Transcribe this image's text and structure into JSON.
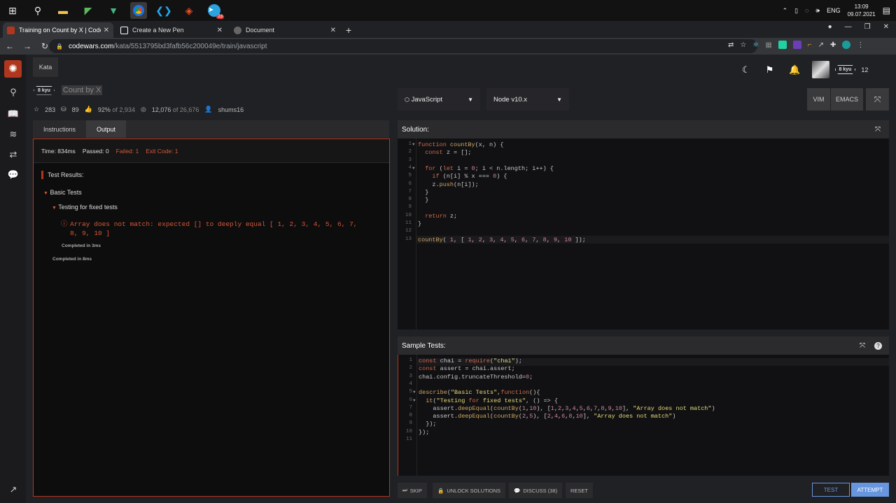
{
  "taskbar": {
    "time": "13:09",
    "date": "09.07.2021",
    "lang": "ENG",
    "badge_count": "23",
    "notif_count": "1"
  },
  "tabs": [
    {
      "label": "Training on Count by X | Codewars",
      "active": true,
      "color": "#b1361e"
    },
    {
      "label": "Create a New Pen",
      "active": false,
      "color": "#ffffff"
    },
    {
      "label": "Document",
      "active": false,
      "color": "#666666"
    }
  ],
  "address": {
    "host": "codewars.com",
    "path": "/kata/5513795bd3fafb56c200049e/train/javascript"
  },
  "header": {
    "kata_tab": "Kata",
    "user_rank": "8 kyu",
    "honor": "12"
  },
  "kata": {
    "rank": "8 kyu",
    "title": "Count by X",
    "stars": "283",
    "votes": "89",
    "satisfaction": "92%",
    "satisfaction_of": "of 2,934",
    "completed": "12,076",
    "completed_of": "of 26,676",
    "author": "shums16"
  },
  "panel_tabs": {
    "instructions": "Instructions",
    "output": "Output"
  },
  "run": {
    "time": "Time: 834ms",
    "passed": "Passed: 0",
    "failed": "Failed: 1",
    "exit": "Exit Code: 1"
  },
  "results": {
    "heading": "Test Results:",
    "group": "Basic Tests",
    "subgroup": "Testing for fixed tests",
    "error_line1": "Array does not match: expected [] to deeply equal [ 1, 2, 3, 4, 5, 6, 7,",
    "error_line2": "8, 9, 10 ]",
    "completed_inner": "Completed in 3ms",
    "completed_outer": "Completed in 8ms"
  },
  "toolbar": {
    "language": "JavaScript",
    "runtime": "Node v10.x",
    "vim": "VIM",
    "emacs": "EMACS"
  },
  "solution": {
    "title": "Solution:",
    "lines": [
      "function countBy(x, n) {",
      "  const z = [];",
      "",
      "  for (let i = 0; i < n.length; i++) {",
      "    if (n[i] % x === 0) {",
      "    z.push(n[i]);",
      "  }",
      "  }",
      "",
      "  return z;",
      "}",
      "",
      "countBy( 1, [ 1, 2, 3, 4, 5, 6, 7, 8, 9, 10 ]);"
    ]
  },
  "sample": {
    "title": "Sample Tests:",
    "lines": [
      "const chai = require(\"chai\");",
      "const assert = chai.assert;",
      "chai.config.truncateThreshold=0;",
      "",
      "describe(\"Basic Tests\",function(){",
      "  it(\"Testing for fixed tests\", () => {",
      "    assert.deepEqual(countBy(1,10), [1,2,3,4,5,6,7,8,9,10], \"Array does not match\")",
      "    assert.deepEqual(countBy(2,5), [2,4,6,8,10], \"Array does not match\")",
      "  });",
      "});",
      ""
    ]
  },
  "actions": {
    "skip": "SKIP",
    "unlock": "UNLOCK SOLUTIONS",
    "discuss": "DISCUSS (38)",
    "reset": "RESET",
    "test": "TEST",
    "attempt": "ATTEMPT"
  }
}
